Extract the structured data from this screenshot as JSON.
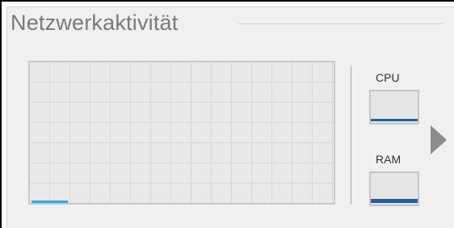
{
  "panel": {
    "title": "Netzwerkaktivität"
  },
  "network_graph": {
    "activity_fraction": 0.12
  },
  "meters": {
    "cpu": {
      "label": "CPU",
      "level_fraction": 0.08
    },
    "ram": {
      "label": "RAM",
      "level_fraction": 0.14
    }
  },
  "expand": {
    "icon": "triangle-right-icon"
  },
  "colors": {
    "panel_background": "#f0f0f0",
    "title_text": "#7a7a7a",
    "graph_activity": "#39a6ee",
    "meter_fill": "#1d5fa8",
    "arrow": "#8c8c8c"
  }
}
